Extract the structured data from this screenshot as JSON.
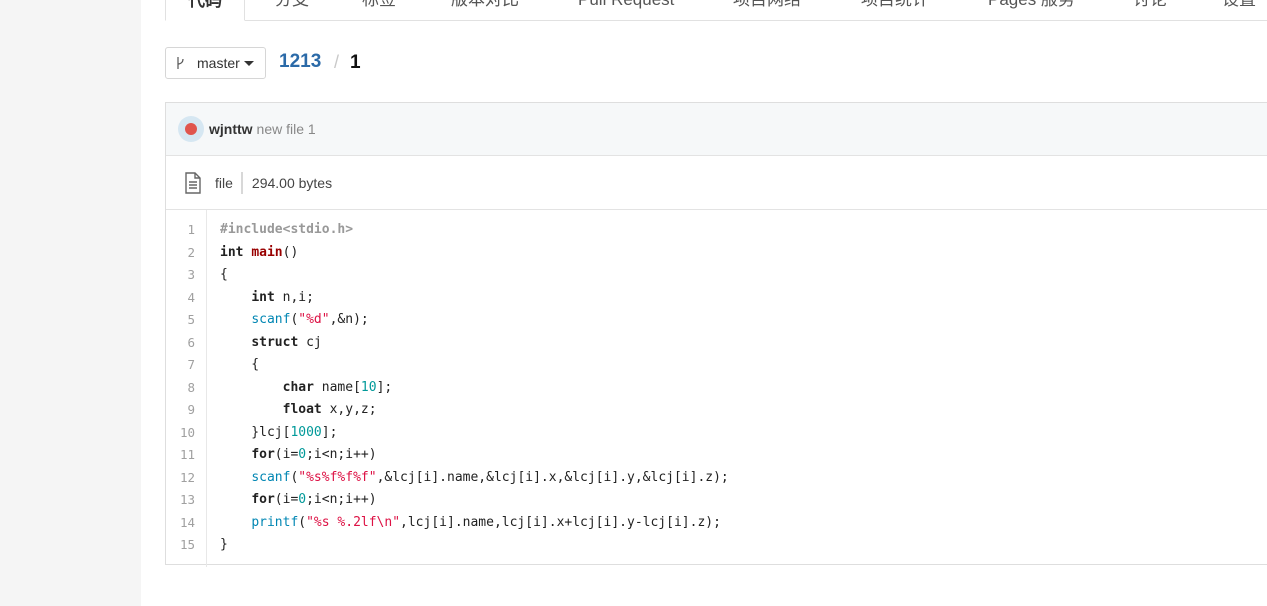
{
  "tabs": [
    "代码",
    "分支",
    "标签",
    "版本对比",
    "Pull Request",
    "项目网络",
    "项目统计",
    "Pages 服务",
    "讨论",
    "设置"
  ],
  "branch": {
    "name": "master"
  },
  "breadcrumb": {
    "repo": "1213",
    "separator": "/",
    "file": "1"
  },
  "commit": {
    "user": "wjnttw",
    "message": "new file 1"
  },
  "file": {
    "type_label": "file",
    "size": "294.00 bytes"
  },
  "code": {
    "line_numbers": [
      "1",
      "2",
      "3",
      "4",
      "5",
      "6",
      "7",
      "8",
      "9",
      "10",
      "11",
      "12",
      "13",
      "14",
      "15"
    ],
    "lines": [
      "#include<stdio.h>",
      "int main()",
      "{",
      "    int n,i;",
      "    scanf(\"%d\",&n);",
      "    struct cj",
      "    {",
      "        char name[10];",
      "        float x,y,z;",
      "    }lcj[1000];",
      "    for(i=0;i<n;i++)",
      "    scanf(\"%s%f%f%f\",&lcj[i].name,&lcj[i].x,&lcj[i].y,&lcj[i].z);",
      "    for(i=0;i<n;i++)",
      "    printf(\"%s %.2lf\\n\",lcj[i].name,lcj[i].x+lcj[i].y-lcj[i].z);",
      "}"
    ]
  }
}
